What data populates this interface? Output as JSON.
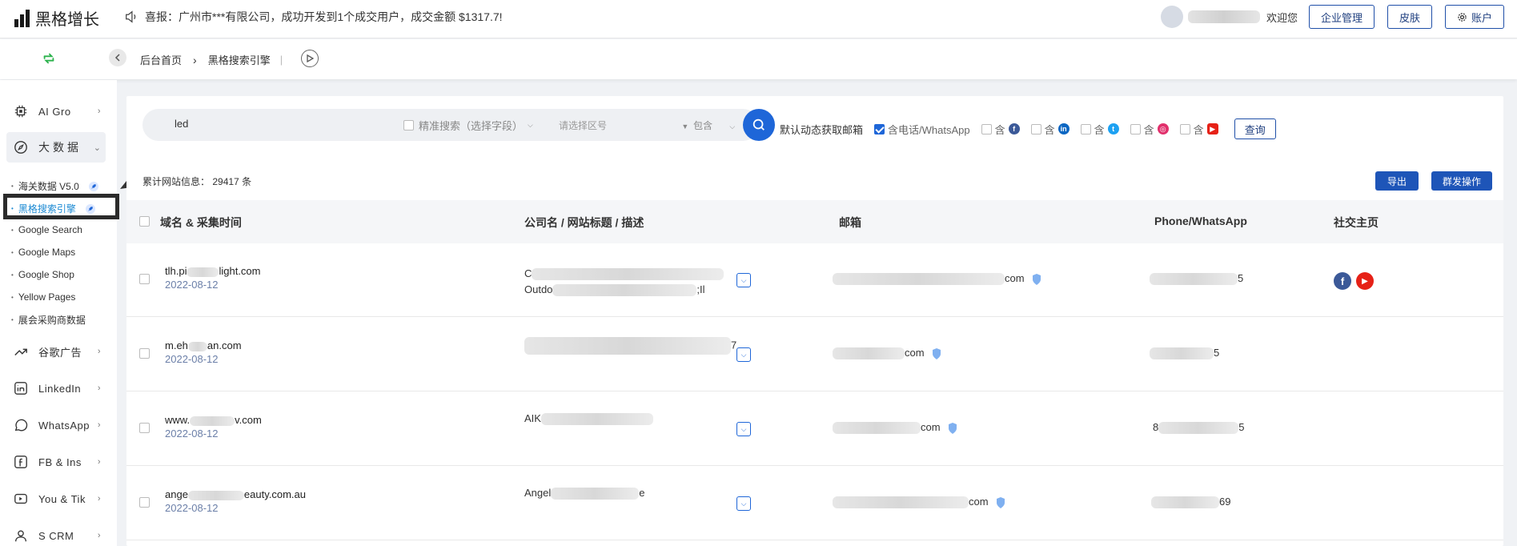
{
  "header": {
    "logo_text": "黑格增长",
    "notice": "喜报：广州市***有限公司，成功开发到1个成交用户，成交金额 $1317.7!",
    "welcome": "欢迎您",
    "btn_enterprise": "企业管理",
    "btn_skin": "皮肤",
    "btn_account": "账户"
  },
  "breadcrumb": {
    "home": "后台首页",
    "current": "黑格搜索引擎",
    "bar": "|"
  },
  "sidebar": {
    "items": [
      {
        "label": "AI Gro",
        "icon": "chip-icon"
      },
      {
        "label": "大数据",
        "icon": "compass-icon"
      },
      {
        "label": "谷歌广告",
        "icon": "trend-icon"
      },
      {
        "label": "LinkedIn",
        "icon": "linkedin-icon"
      },
      {
        "label": "WhatsApp",
        "icon": "whatsapp-icon"
      },
      {
        "label": "FB & Ins",
        "icon": "facebook-icon"
      },
      {
        "label": "You & Tik",
        "icon": "youtube-icon"
      },
      {
        "label": "S CRM",
        "icon": "crm-icon"
      }
    ],
    "sub_items": [
      "海关数据 V5.0",
      "黑格搜索引擎",
      "Google Search",
      "Google Maps",
      "Google Shop",
      "Yellow Pages",
      "展会采购商数据"
    ]
  },
  "search": {
    "query": "led",
    "precise_label": "精准搜索（选择字段）",
    "region_placeholder": "请选择区号",
    "match_mode": "包含",
    "default_email": "默认动态获取邮箱",
    "opt_phone": "含电话/WhatsApp",
    "opt_prefix": "含",
    "query_button": "查询"
  },
  "results": {
    "count_label": "累计网站信息：",
    "count_value": "29417 条",
    "export": "导出",
    "mass_action": "群发操作"
  },
  "table": {
    "headers": [
      "域名 & 采集时间",
      "公司名 / 网站标题 / 描述",
      "邮箱",
      "Phone/WhatsApp",
      "社交主页"
    ],
    "rows": [
      {
        "domain": "tlh.pi",
        "domain_tail": "light.com",
        "date": "2022-08-12",
        "title_a": "C",
        "title_b": "Outdo",
        "title_b_tail": ";Il",
        "email_tail": "com",
        "phone_tail": "5",
        "social": [
          "facebook",
          "youtube"
        ]
      },
      {
        "domain": "m.eh",
        "domain_tail": "an.com",
        "date": "2022-08-12",
        "title_a": "",
        "title_tail": "7",
        "email_tail": "com",
        "phone_tail": "5"
      },
      {
        "domain": "www.",
        "domain_tail": "v.com",
        "date": "2022-08-12",
        "title_a": "AIK",
        "email_tail": "com",
        "phone_tail": "8",
        "phone_end": "5"
      },
      {
        "domain": "ange",
        "domain_tail": "eauty.com.au",
        "date": "2022-08-12",
        "title_a": "Angel",
        "title_b_tail": "e",
        "email_tail": "com",
        "phone_tail": "69"
      }
    ]
  },
  "colors": {
    "primary": "#1e66d8",
    "link": "#1c8ad3",
    "date": "#6b7fa8"
  }
}
